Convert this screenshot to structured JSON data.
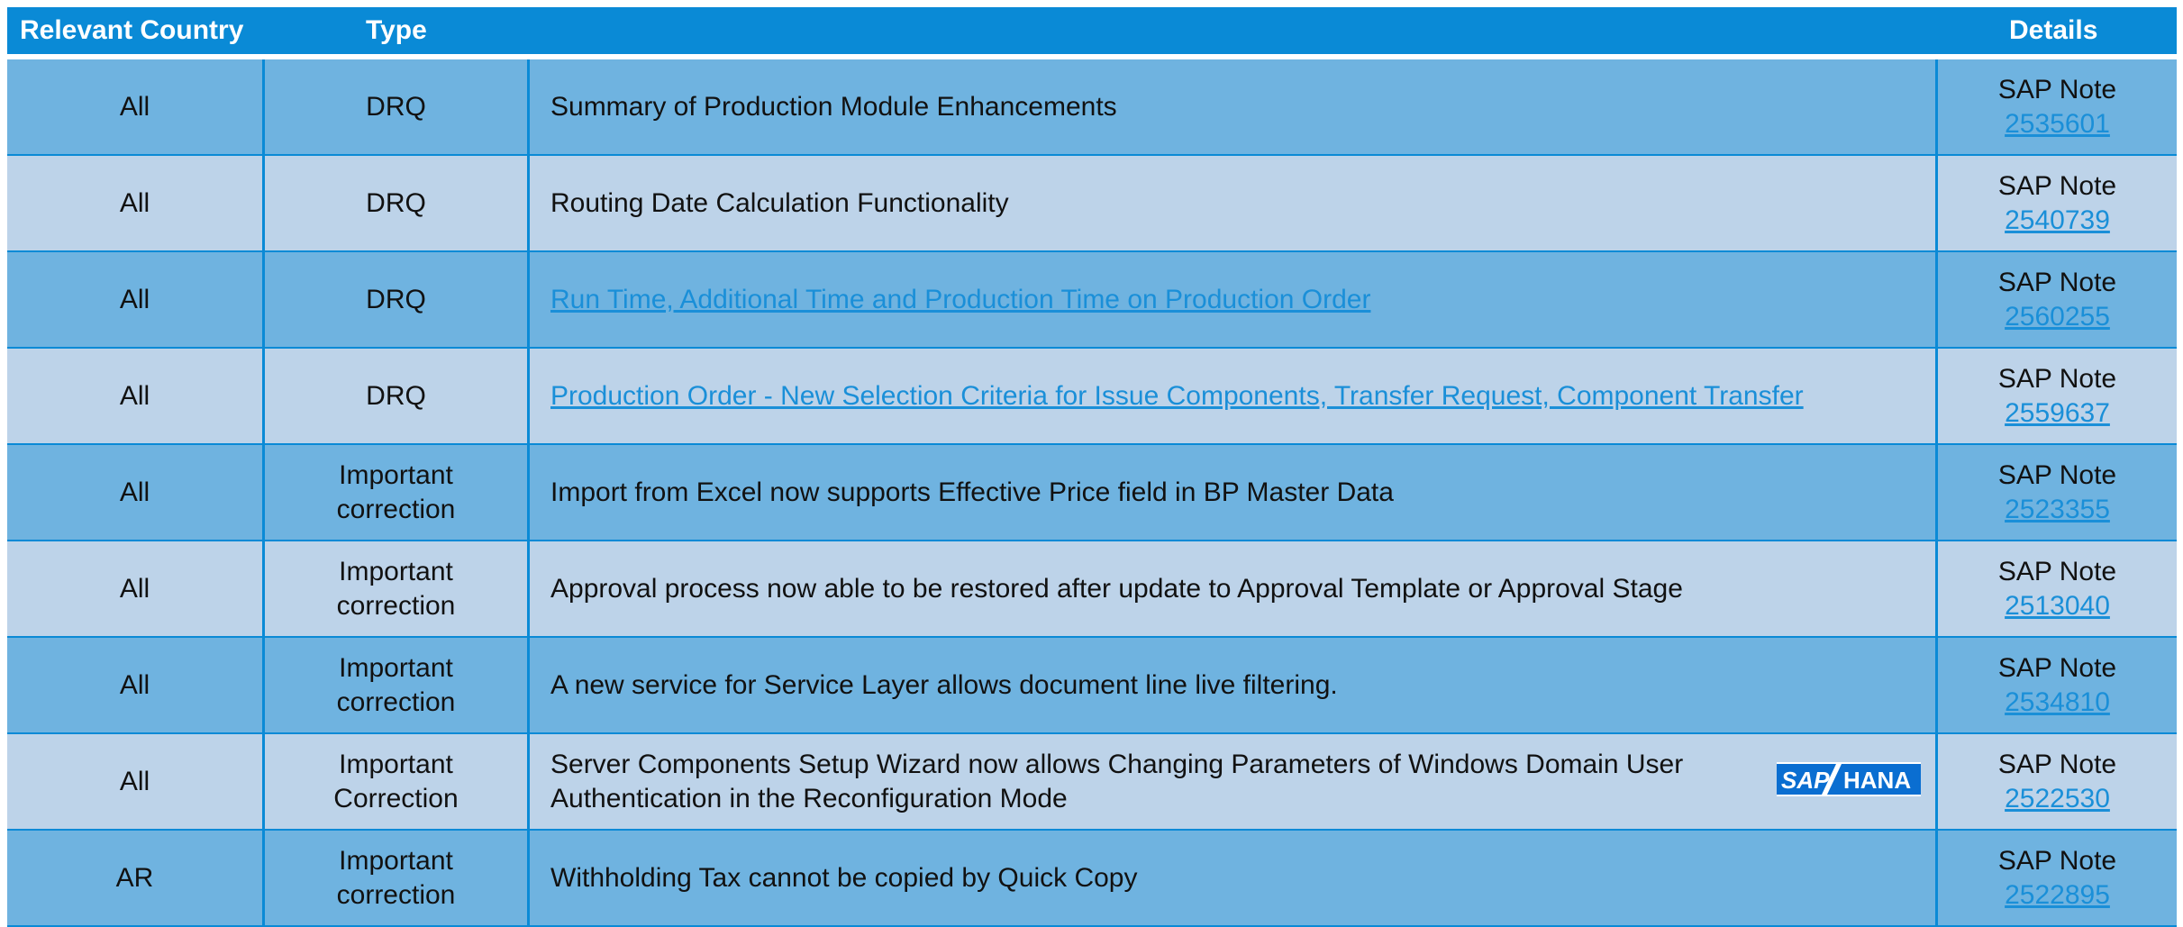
{
  "header": {
    "country": "Relevant Country",
    "type": "Type",
    "details": "Details"
  },
  "logo": {
    "sap": "SAP",
    "hana": "HANA",
    "colors": {
      "sap_blue": "#0a6ed1",
      "white": "#ffffff"
    }
  },
  "colors": {
    "header_bg": "#0a8ad6",
    "row_dark": "#6fb3e0",
    "row_light": "#bdd3e9",
    "link": "#1a8fd8"
  },
  "rows": [
    {
      "country": "All",
      "type": "DRQ",
      "desc": "Summary of Production Module Enhancements",
      "desc_is_link": false,
      "note_label": "SAP Note",
      "note_number": "2535601"
    },
    {
      "country": "All",
      "type": "DRQ",
      "desc": "Routing Date Calculation Functionality",
      "desc_is_link": false,
      "note_label": "SAP Note",
      "note_number": "2540739"
    },
    {
      "country": "All",
      "type": "DRQ",
      "desc": "Run Time, Additional Time and Production Time on Production Order",
      "desc_is_link": true,
      "note_label": "SAP Note",
      "note_number": "2560255"
    },
    {
      "country": "All",
      "type": "DRQ",
      "desc": "Production Order - New Selection Criteria for Issue Components, Transfer Request, Component Transfer",
      "desc_is_link": true,
      "note_label": "SAP Note",
      "note_number": "2559637"
    },
    {
      "country": "All",
      "type_line1": "Important",
      "type_line2": "correction",
      "desc": "Import from Excel now supports Effective Price field in BP Master Data",
      "desc_is_link": false,
      "note_label": "SAP Note",
      "note_number": "2523355"
    },
    {
      "country": "All",
      "type_line1": "Important",
      "type_line2": "correction",
      "desc": "Approval process now able to be restored after update to Approval Template or Approval Stage",
      "desc_is_link": false,
      "note_label": "SAP Note",
      "note_number": "2513040"
    },
    {
      "country": "All",
      "type_line1": "Important",
      "type_line2": "correction",
      "desc": "A new service for Service Layer allows document line live filtering.",
      "desc_is_link": false,
      "note_label": "SAP Note",
      "note_number": "2534810"
    },
    {
      "country": "All",
      "type_line1": "Important",
      "type_line2": "Correction",
      "desc_line1": "Server Components Setup Wizard now allows Changing Parameters of Windows Domain User",
      "desc_line2": "Authentication in the Reconfiguration Mode",
      "desc_is_link": false,
      "note_label": "SAP Note",
      "note_number": "2522530"
    },
    {
      "country": "AR",
      "type_line1": "Important",
      "type_line2": "correction",
      "desc": "Withholding Tax cannot be copied by Quick Copy",
      "desc_is_link": false,
      "note_label": "SAP Note",
      "note_number": "2522895"
    }
  ]
}
